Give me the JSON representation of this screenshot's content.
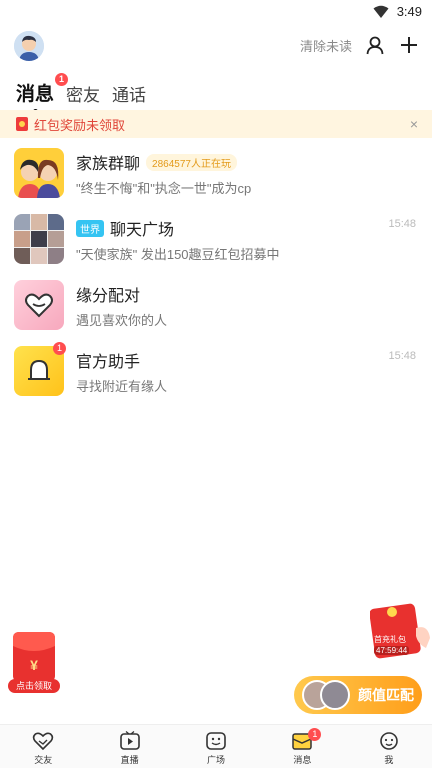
{
  "status_bar": {
    "time": "3:49"
  },
  "header": {
    "clear_unread_label": "清除未读"
  },
  "tabs": [
    {
      "label": "消息",
      "active": true,
      "badge": "1"
    },
    {
      "label": "密友",
      "active": false
    },
    {
      "label": "通话",
      "active": false
    }
  ],
  "notice": {
    "text": "红包奖励未领取",
    "close": "×"
  },
  "conversations": [
    {
      "title": "家族群聊",
      "tag": "2864577人正在玩",
      "subtitle": "\"终生不悔\"和\"执念一世\"成为cp",
      "time": ""
    },
    {
      "title": "聊天广场",
      "tag": "世界",
      "subtitle": "\"天使家族\" 发出150趣豆红包招募中",
      "time": "15:48"
    },
    {
      "title": "缘分配对",
      "subtitle": "遇见喜欢你的人",
      "time": ""
    },
    {
      "title": "官方助手",
      "subtitle": "寻找附近有缘人",
      "time": "15:48",
      "badge": "1"
    }
  ],
  "side_redpacket": {
    "label": "点击领取",
    "symbol": "¥"
  },
  "side_gift": {
    "label": "首充礼包",
    "countdown": "47:59:44"
  },
  "match_button": {
    "label": "颜值匹配"
  },
  "tabbar": [
    {
      "label": "交友",
      "icon": "heart-icon"
    },
    {
      "label": "直播",
      "icon": "tv-play-icon"
    },
    {
      "label": "广场",
      "icon": "smile-square-icon"
    },
    {
      "label": "消息",
      "icon": "message-icon",
      "badge": "1",
      "active": true
    },
    {
      "label": "我",
      "icon": "face-icon"
    }
  ],
  "colors": {
    "accent": "#ff4d4f",
    "notice_bg": "#fff5e0",
    "match_gradient": "#ffb02e",
    "world_tag": "#35c4f2"
  }
}
